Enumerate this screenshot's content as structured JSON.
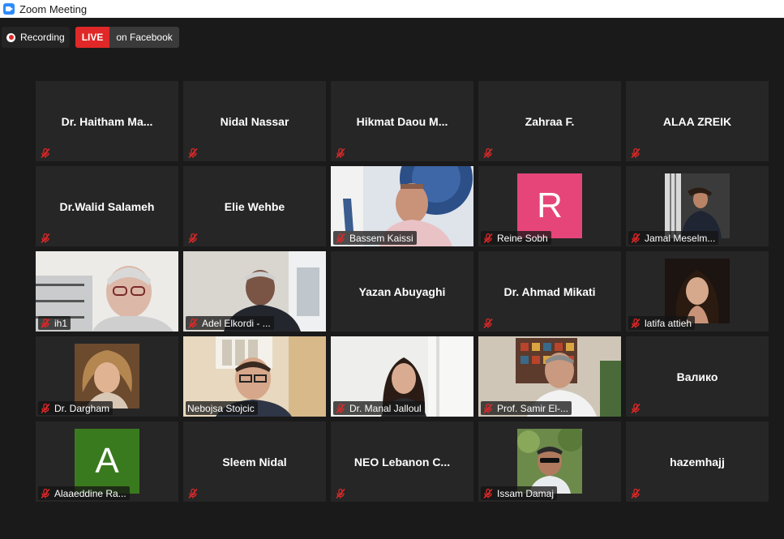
{
  "window": {
    "title": "Zoom Meeting"
  },
  "recording": {
    "label": "Recording"
  },
  "live": {
    "badge": "LIVE",
    "destination": "on Facebook"
  },
  "colors": {
    "live_red": "#e02828",
    "active_speaker": "#d4e65a",
    "tile_bg": "#262626",
    "mic_muted": "#e02828"
  },
  "participants": [
    {
      "name": "Dr.  Haitham  Ma...",
      "kind": "name"
    },
    {
      "name": "Nidal Nassar",
      "kind": "name"
    },
    {
      "name": "Hikmat  Daou  M...",
      "kind": "name"
    },
    {
      "name": "Zahraa F.",
      "kind": "name"
    },
    {
      "name": "ALAA ZREIK",
      "kind": "name"
    },
    {
      "name": "Dr.Walid Salameh",
      "kind": "name"
    },
    {
      "name": "Elie Wehbe",
      "kind": "name"
    },
    {
      "label": "Bassem Kaissi",
      "kind": "video"
    },
    {
      "label": "Reine Sobh",
      "kind": "letter",
      "letter": "R",
      "color": "#e6457a"
    },
    {
      "label": "Jamal Meselm...",
      "kind": "photo"
    },
    {
      "label": "ih1",
      "kind": "video"
    },
    {
      "label": "Adel Elkordi - ...",
      "kind": "video"
    },
    {
      "name": "Yazan Abuyaghi",
      "kind": "name"
    },
    {
      "name": "Dr. Ahmad Mikati",
      "kind": "name"
    },
    {
      "label": "latifa attieh",
      "kind": "photo"
    },
    {
      "label": "Dr. Dargham",
      "kind": "photo"
    },
    {
      "label": "Nebojsa Stojcic",
      "kind": "video",
      "active": true
    },
    {
      "label": "Dr. Manal Jalloul",
      "kind": "video"
    },
    {
      "label": "Prof. Samir El-...",
      "kind": "video"
    },
    {
      "name": "Валико",
      "kind": "name"
    },
    {
      "label": "Alaaeddine Ra...",
      "kind": "letter",
      "letter": "A",
      "color": "#3a7a1e"
    },
    {
      "name": "Sleem Nidal",
      "kind": "name"
    },
    {
      "name": "NEO  Lebanon  C...",
      "kind": "name"
    },
    {
      "label": "Issam Damaj",
      "kind": "photo"
    },
    {
      "name": "hazemhajj",
      "kind": "name"
    }
  ]
}
